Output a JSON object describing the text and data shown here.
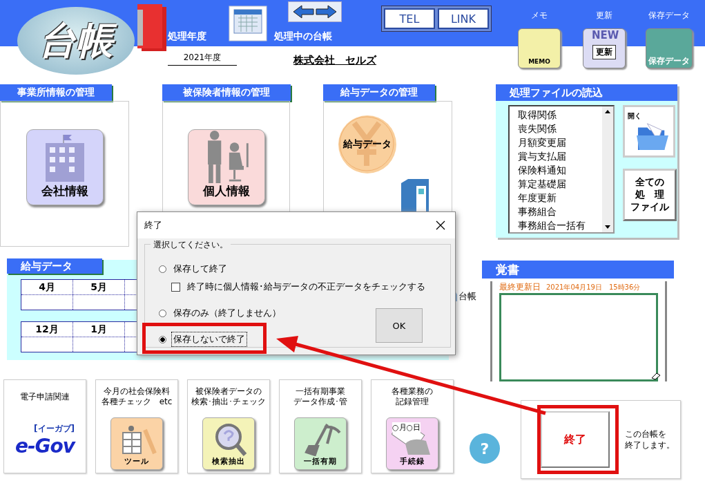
{
  "header": {
    "logo": "台帳",
    "year_label": "処理年度",
    "year": "2021年度",
    "ledger_label": "処理中の台帳",
    "company": "株式会社　セルズ",
    "links": [
      "TEL",
      "LINK"
    ],
    "tools": [
      {
        "label": "メモ",
        "icon_text": "MEMO",
        "kind": "memo"
      },
      {
        "label": "更新",
        "icon_text": "更新",
        "badge": "NEW",
        "kind": "update"
      },
      {
        "label": "保存データ",
        "icon_text": "保存データ",
        "kind": "save"
      }
    ]
  },
  "modules": [
    {
      "title": "事業所情報の管理",
      "button": "会社情報",
      "kind": "company"
    },
    {
      "title": "被保険者情報の管理",
      "button": "個人情報",
      "kind": "person"
    },
    {
      "title": "給与データの管理",
      "button": "給与データ",
      "kind": "salary"
    }
  ],
  "file_panel": {
    "title": "処理ファイルの読込",
    "files": [
      "取得関係",
      "喪失関係",
      "月額変更届",
      "賞与支払届",
      "保険料通知",
      "算定基礎届",
      "年度更新",
      "事務組合",
      "事務組合一括有"
    ],
    "open_button": "開く",
    "all_button": [
      "全ての",
      "処　理",
      "ファイル"
    ]
  },
  "salary": {
    "title": "給与データ",
    "rows": [
      [
        "4月",
        "5月"
      ],
      [
        "12月",
        "1月"
      ]
    ]
  },
  "ledger_shortcut": "台帳",
  "memo": {
    "title": "覚書",
    "updated_label": "最終更新日",
    "updated": "2021年04月19日　15時36分"
  },
  "tiles": [
    {
      "kind": "egov",
      "caption": [
        "電子申請関連"
      ],
      "label": "e-Gov",
      "sub": "[イーガブ]"
    },
    {
      "kind": "tool",
      "caption": [
        "今月の社会保険料",
        "各種チェック　etc"
      ],
      "label": "ツール"
    },
    {
      "kind": "search",
      "caption": [
        "被保険者データの",
        "検索･抽出･チェック"
      ],
      "label": "検索抽出"
    },
    {
      "kind": "bulk",
      "caption": [
        "一括有期事業",
        "データ作成･管"
      ],
      "label": "一括有期"
    },
    {
      "kind": "record",
      "caption": [
        "各種業務の",
        "記録管理"
      ],
      "label": "手続録",
      "card_text": "○月○日"
    }
  ],
  "help": "?",
  "exit": {
    "button": "終了",
    "note": [
      "この台帳を",
      "終了します。"
    ]
  },
  "dialog": {
    "title": "終了",
    "group": "選択してください。",
    "ok": "OK",
    "options": [
      {
        "kind": "radio",
        "label": "保存して終了",
        "selected": false
      },
      {
        "kind": "checkbox",
        "label": "終了時に個人情報･給与データの不正データをチェックする",
        "checked": false
      },
      {
        "kind": "radio",
        "label": "保存のみ（終了しません）",
        "selected": false
      },
      {
        "kind": "radio",
        "label": "保存しないで終了",
        "selected": true
      }
    ]
  }
}
